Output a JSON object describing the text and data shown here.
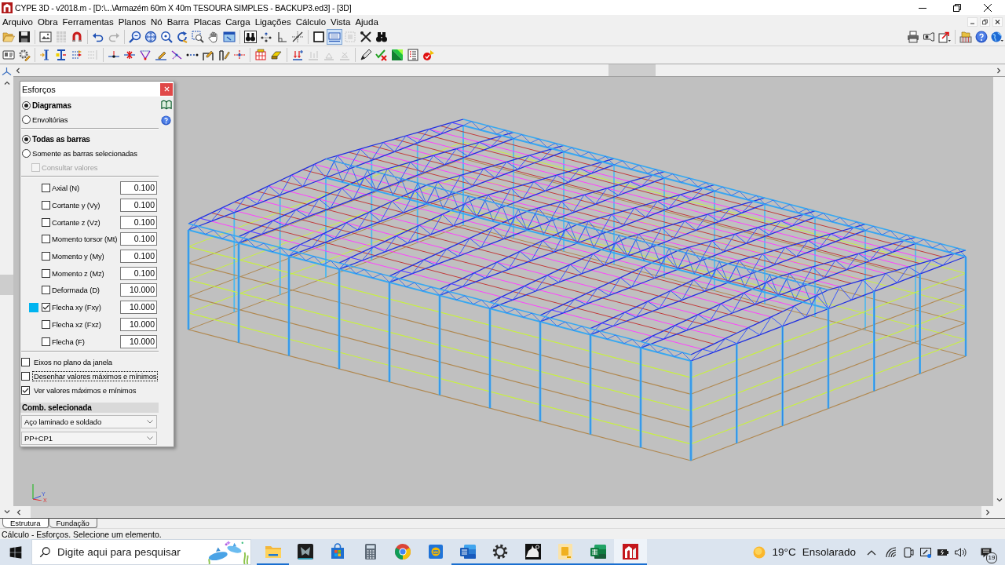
{
  "window": {
    "title": "CYPE 3D - v2018.m - [D:\\...\\Armazém 60m X 40m TESOURA SIMPLES - BACKUP3.ed3] - [3D]"
  },
  "menu": [
    "Arquivo",
    "Obra",
    "Ferramentas",
    "Planos",
    "Nó",
    "Barra",
    "Placas",
    "Carga",
    "Ligações",
    "Cálculo",
    "Vista",
    "Ajuda"
  ],
  "toolbar_1": {
    "left": [
      [
        {
          "disabled": false,
          "pressed": false
        },
        {
          "disabled": false,
          "pressed": false
        }
      ],
      [
        {
          "disabled": false,
          "pressed": false
        },
        {
          "disabled": true,
          "pressed": false
        },
        {
          "disabled": false,
          "pressed": false
        }
      ],
      [
        {
          "disabled": false,
          "pressed": false
        },
        {
          "disabled": true,
          "pressed": false
        }
      ],
      [
        {
          "disabled": false,
          "pressed": false
        },
        {
          "disabled": false,
          "pressed": false
        },
        {
          "disabled": false,
          "pressed": false
        },
        {
          "disabled": false,
          "pressed": false
        },
        {
          "disabled": false,
          "pressed": false
        },
        {
          "disabled": false,
          "pressed": false
        },
        {
          "disabled": false,
          "pressed": false
        }
      ],
      [
        {
          "disabled": false,
          "pressed": false
        },
        {
          "disabled": false,
          "pressed": false
        },
        {
          "disabled": false,
          "pressed": false
        },
        {
          "disabled": false,
          "pressed": false
        }
      ],
      [
        {
          "disabled": false,
          "pressed": false
        },
        {
          "disabled": false,
          "pressed": true
        },
        {
          "disabled": true,
          "pressed": false
        },
        {
          "disabled": false,
          "pressed": false
        },
        {
          "disabled": false,
          "pressed": false
        }
      ]
    ],
    "right": [
      [
        {
          "disabled": false,
          "pressed": false
        },
        {
          "disabled": false,
          "pressed": false
        },
        {
          "disabled": false,
          "pressed": false
        }
      ],
      [
        {
          "disabled": false,
          "pressed": false
        },
        {
          "disabled": false,
          "pressed": false
        },
        {
          "disabled": false,
          "pressed": false
        }
      ]
    ]
  },
  "toolbar_2": [
    [
      {
        "disabled": false
      },
      {
        "disabled": false
      }
    ],
    [
      {
        "disabled": false
      },
      {
        "disabled": false
      },
      {
        "disabled": false
      },
      {
        "disabled": true
      }
    ],
    [
      {
        "disabled": false
      },
      {
        "disabled": false
      },
      {
        "disabled": false
      },
      {
        "disabled": false
      },
      {
        "disabled": false
      },
      {
        "disabled": false
      },
      {
        "disabled": false
      },
      {
        "disabled": false
      },
      {
        "disabled": false
      }
    ],
    [
      {
        "disabled": false
      },
      {
        "disabled": false
      }
    ],
    [
      {
        "disabled": false
      },
      {
        "disabled": true
      },
      {
        "disabled": true
      },
      {
        "disabled": true
      }
    ],
    [
      {
        "disabled": false
      },
      {
        "disabled": false
      },
      {
        "disabled": false
      },
      {
        "disabled": false
      },
      {
        "disabled": false
      }
    ]
  ],
  "view": {
    "axis_labels": [
      "Y",
      "X"
    ]
  },
  "dialog": {
    "title": "Esforços",
    "mode_options": [
      {
        "label": "Diagramas",
        "selected": true
      },
      {
        "label": "Envoltórias",
        "selected": false
      }
    ],
    "scope_options": [
      {
        "label": "Todas as barras",
        "selected": true
      },
      {
        "label": "Somente as barras selecionadas",
        "selected": false
      }
    ],
    "query_values": {
      "label": "Consultar valores",
      "checked": false,
      "disabled": true
    },
    "diagrams": [
      {
        "label": "Axial (N)",
        "checked": false,
        "value": "0.100"
      },
      {
        "label": "Cortante y (Vy)",
        "checked": false,
        "value": "0.100"
      },
      {
        "label": "Cortante z (Vz)",
        "checked": false,
        "value": "0.100"
      },
      {
        "label": "Momento torsor (Mt)",
        "checked": false,
        "value": "0.100"
      },
      {
        "label": "Momento y (My)",
        "checked": false,
        "value": "0.100"
      },
      {
        "label": "Momento z (Mz)",
        "checked": false,
        "value": "0.100"
      },
      {
        "label": "Deformada (D)",
        "checked": false,
        "value": "10.000"
      },
      {
        "label": "Flecha xy (Fxy)",
        "checked": true,
        "value": "10.000",
        "color": "#00b4f0"
      },
      {
        "label": "Flecha xz (Fxz)",
        "checked": false,
        "value": "10.000"
      },
      {
        "label": "Flecha (F)",
        "checked": false,
        "value": "10.000"
      }
    ],
    "options": [
      {
        "label": "Eixos no plano da janela",
        "checked": false,
        "focused": false
      },
      {
        "label": "Desenhar valores máximos e mínimos",
        "checked": false,
        "focused": true
      },
      {
        "label": "Ver valores máximos e mínimos",
        "checked": true,
        "focused": false
      }
    ],
    "combination": {
      "heading": "Comb. selecionada",
      "material": "Aço laminado e soldado",
      "case": "PP+CP1"
    }
  },
  "tabs": [
    {
      "label": "Estrutura",
      "selected": true
    },
    {
      "label": "Fundação",
      "selected": false
    }
  ],
  "status_bar": {
    "text": "Cálculo - Esforços. Selecione um elemento."
  },
  "taskbar": {
    "search": {
      "placeholder": "Digite aqui para pesquisar"
    },
    "apps": [
      {
        "running": true,
        "active": false
      },
      {
        "running": false,
        "active": false
      },
      {
        "running": false,
        "active": false
      },
      {
        "running": false,
        "active": false
      },
      {
        "running": false,
        "active": false
      },
      {
        "running": false,
        "active": false
      },
      {
        "running": true,
        "active": false
      },
      {
        "running": true,
        "active": false
      },
      {
        "running": true,
        "active": false
      },
      {
        "running": true,
        "active": false
      },
      {
        "running": true,
        "active": false
      },
      {
        "running": true,
        "active": true
      }
    ],
    "weather": {
      "temperature": "19°C",
      "condition": "Ensolarado"
    },
    "notifications": {
      "count": "19"
    }
  }
}
